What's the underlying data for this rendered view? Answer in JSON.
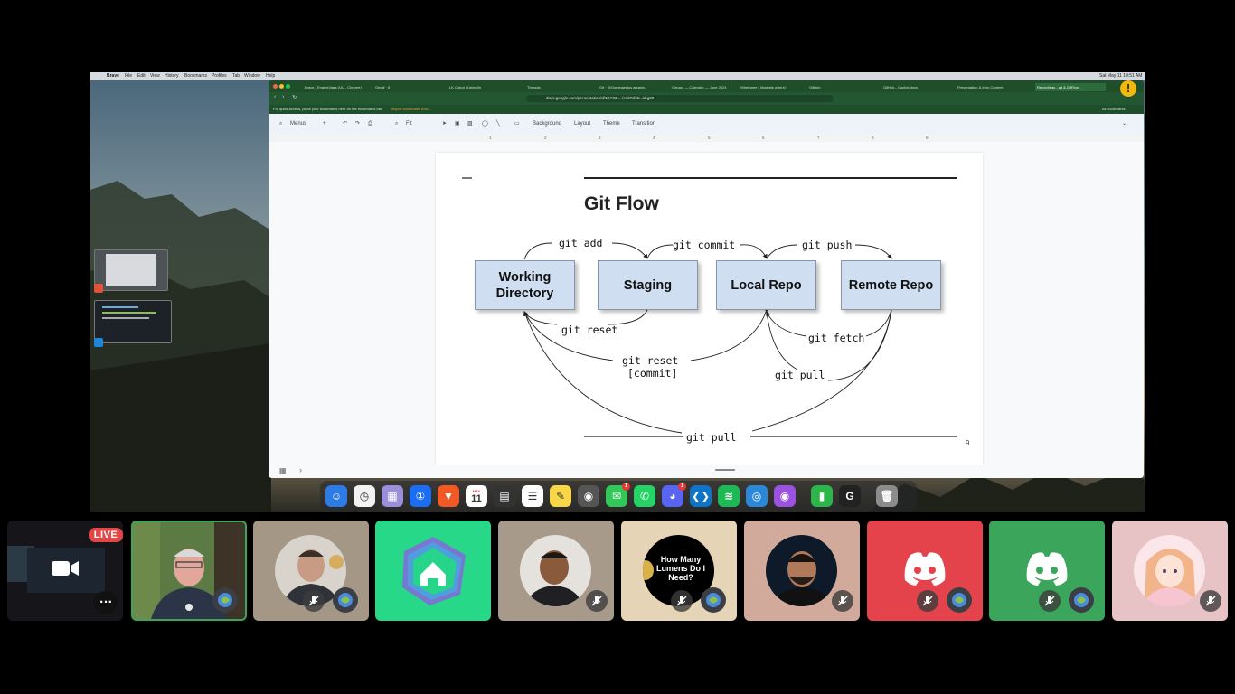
{
  "browser": {
    "tabs": [
      "Brave - EngineVaga (UU - Chrome)",
      "Gmail · 8",
      "LK Cobot | LinkedIn",
      "Threads",
      "Git · @Gomegavijus arcanis",
      "Chrogo — Calendar — June 2024",
      "Wireframe | Illustrate wire(s)",
      "GitHub",
      "GitHub - Copilot docs",
      "Presentation & Intro Content",
      "Recordings - git & GitFlow"
    ],
    "url": "docs.google.com/presentation/d/1KYGL…/edit#slide=id.g29",
    "bookmarks_hint": "For quick access, place your bookmarks here on the bookmarks bar.",
    "bookmarks_import": "Import bookmarks now…",
    "all_bookmarks": "All Bookmarks"
  },
  "toolbar": {
    "menus_label": "Menus",
    "zoom_label": "Fit",
    "background_label": "Background",
    "layout_label": "Layout",
    "theme_label": "Theme",
    "transition_label": "Transition"
  },
  "ruler": [
    "1",
    "2",
    "3",
    "4",
    "5",
    "6",
    "7",
    "8",
    "9"
  ],
  "slide": {
    "title": "Git Flow",
    "boxes": {
      "working": "Working Directory",
      "staging": "Staging",
      "local": "Local Repo",
      "remote": "Remote Repo"
    },
    "commands": {
      "git_add": "git add",
      "git_commit": "git commit",
      "git_push": "git push",
      "git_reset": "git reset",
      "git_reset_commit_1": "git reset",
      "git_reset_commit_2": "[commit]",
      "git_fetch": "git fetch",
      "git_pull_local": "git pull",
      "git_pull_bottom": "git pull"
    },
    "number": "9"
  },
  "menubar": {
    "app": "Brave",
    "items": [
      "File",
      "Edit",
      "View",
      "History",
      "Bookmarks",
      "Profiles",
      "Tab",
      "Window",
      "Help"
    ],
    "clock": "Sat May 11 10:51 AM"
  },
  "dock": {
    "apps": [
      {
        "name": "Finder",
        "color": "#2d7be5",
        "glyph": "☺"
      },
      {
        "name": "Clock",
        "color": "#f2f2f2",
        "glyph": "◷"
      },
      {
        "name": "Launchpad",
        "color": "#9a8fd8",
        "glyph": "▦"
      },
      {
        "name": "1Password",
        "color": "#1a6ef5",
        "glyph": "①"
      },
      {
        "name": "Brave",
        "color": "#f15a24",
        "glyph": "▼"
      },
      {
        "name": "Calendar",
        "color": "#ffffff",
        "glyph": "11"
      },
      {
        "name": "Calculator",
        "color": "#333333",
        "glyph": "▤"
      },
      {
        "name": "Reminders",
        "color": "#ffffff",
        "glyph": "☰"
      },
      {
        "name": "Notes",
        "color": "#f9d648",
        "glyph": "✎"
      },
      {
        "name": "Screenshot",
        "color": "#555555",
        "glyph": "◉"
      },
      {
        "name": "Messages",
        "color": "#33c759",
        "glyph": "✉"
      },
      {
        "name": "WhatsApp",
        "color": "#25d366",
        "glyph": "✆"
      },
      {
        "name": "Discord",
        "color": "#5865f2",
        "glyph": "◕"
      },
      {
        "name": "VS Code",
        "color": "#0e74c8",
        "glyph": "❮❯"
      },
      {
        "name": "Spotify",
        "color": "#1db954",
        "glyph": "≋"
      },
      {
        "name": "Signal",
        "color": "#2b87d8",
        "glyph": "◎"
      },
      {
        "name": "Podcasts",
        "color": "#9b52e0",
        "glyph": "◉"
      },
      {
        "name": "Numbers",
        "color": "#2cb64a",
        "glyph": "▮"
      },
      {
        "name": "Logitech",
        "color": "#222222",
        "glyph": "G"
      },
      {
        "name": "Trash",
        "color": "#8c8c8c",
        "glyph": "🗑"
      }
    ],
    "calendar_month": "MAY",
    "badges": {
      "messages": "1",
      "discord": "1"
    }
  },
  "participants": {
    "live_label": "LIVE",
    "more_label": "…",
    "tile_colors": [
      "#15151a",
      "#5a7f4e",
      "#a59786",
      "#28d889",
      "#a89a8a",
      "#e6d4b6",
      "#d2aa9b",
      "#e4434b",
      "#3aa55b",
      "#e8c3c5"
    ],
    "lumens_text": "How Many Lumens Do I Need?"
  }
}
